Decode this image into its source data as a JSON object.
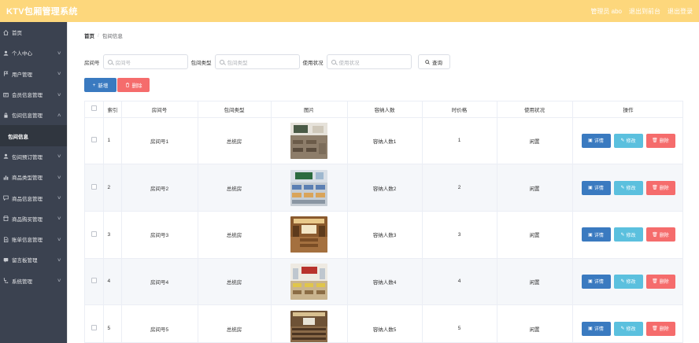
{
  "header": {
    "title": "KTV包厢管理系统",
    "links": [
      "管理员 abo",
      "退出到前台",
      "退出登录"
    ]
  },
  "sidebar": {
    "items": [
      {
        "label": "首页",
        "icon": "home-icon",
        "chevron": ""
      },
      {
        "label": "个人中心",
        "icon": "user-icon",
        "chevron": "∨"
      },
      {
        "label": "用户管理",
        "icon": "flag-icon",
        "chevron": "∨"
      },
      {
        "label": "会员信息管理",
        "icon": "card-icon",
        "chevron": "∨"
      },
      {
        "label": "包间信息管理",
        "icon": "lock-icon",
        "chevron": "∧"
      }
    ],
    "sub_item": "包间信息",
    "items_after": [
      {
        "label": "包间预订管理",
        "icon": "user-icon",
        "chevron": "∨"
      },
      {
        "label": "商品类型管理",
        "icon": "chart-icon",
        "chevron": "∨"
      },
      {
        "label": "商品信息管理",
        "icon": "chat-icon",
        "chevron": "∨"
      },
      {
        "label": "商品购买管理",
        "icon": "shop-icon",
        "chevron": "∨"
      },
      {
        "label": "账单信息管理",
        "icon": "doc-icon",
        "chevron": "∨"
      },
      {
        "label": "留言板管理",
        "icon": "message-icon",
        "chevron": "∨"
      },
      {
        "label": "系统管理",
        "icon": "setting-icon",
        "chevron": "∨"
      }
    ]
  },
  "breadcrumb": {
    "home": "首页",
    "sep": "/",
    "current": "包间信息"
  },
  "search": {
    "room_label": "房间号",
    "room_placeholder": "房间号",
    "type_label": "包间类型",
    "type_placeholder": "包间类型",
    "status_label": "使用状况",
    "status_placeholder": "使用状况",
    "query_button": "查询"
  },
  "actions": {
    "add": "新增",
    "delete": "删除"
  },
  "table": {
    "headers": [
      "",
      "索引",
      "房间号",
      "包间类型",
      "图片",
      "容纳人数",
      "时价格",
      "使用状况",
      "操作"
    ],
    "rows": [
      {
        "index": "1",
        "room": "房间号1",
        "type": "总统房",
        "capacity": "容纳人数1",
        "price": "1",
        "status": "闲置"
      },
      {
        "index": "2",
        "room": "房间号2",
        "type": "总统房",
        "capacity": "容纳人数2",
        "price": "2",
        "status": "闲置"
      },
      {
        "index": "3",
        "room": "房间号3",
        "type": "总统房",
        "capacity": "容纳人数3",
        "price": "3",
        "status": "闲置"
      },
      {
        "index": "4",
        "room": "房间号4",
        "type": "总统房",
        "capacity": "容纳人数4",
        "price": "4",
        "status": "闲置"
      },
      {
        "index": "5",
        "room": "房间号5",
        "type": "总统房",
        "capacity": "容纳人数5",
        "price": "5",
        "status": "闲置"
      }
    ],
    "row_actions": {
      "detail": "详情",
      "edit": "修改",
      "remove": "删除"
    }
  },
  "colors": {
    "header_bg": "#fdd77c",
    "sidebar_bg": "#3b4250",
    "primary": "#3a7ac0",
    "info": "#5bc0de",
    "danger": "#f56c6c"
  }
}
